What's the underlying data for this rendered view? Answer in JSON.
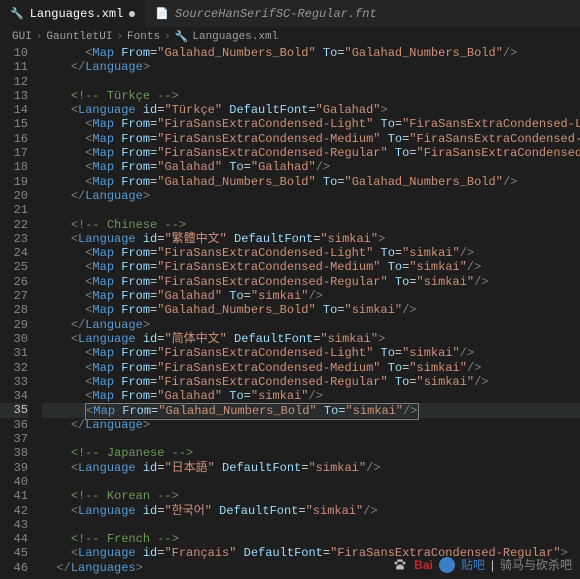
{
  "tabs": [
    {
      "icon": "🔧",
      "label": "Languages.xml",
      "active": true,
      "modified": true
    },
    {
      "icon": "📄",
      "label": "SourceHanSerifSC-Regular.fnt",
      "active": false,
      "modified": false
    }
  ],
  "breadcrumb": {
    "parts": [
      "GUI",
      "GauntletUI",
      "Fonts"
    ],
    "file_icon": "🔧",
    "file": "Languages.xml"
  },
  "code_lines": [
    {
      "n": 10,
      "ind": 3,
      "type": "map_self",
      "from": "Galahad_Numbers_Bold",
      "to": "Galahad_Numbers_Bold"
    },
    {
      "n": 11,
      "ind": 2,
      "type": "close",
      "tag": "Language"
    },
    {
      "n": 12,
      "ind": 0,
      "type": "blank"
    },
    {
      "n": 13,
      "ind": 2,
      "type": "comment",
      "text": " Türkçe "
    },
    {
      "n": 14,
      "ind": 2,
      "type": "lang",
      "id": "Türkçe",
      "font": "Galahad"
    },
    {
      "n": 15,
      "ind": 3,
      "type": "map_self",
      "from": "FiraSansExtraCondensed-Light",
      "to": "FiraSansExtraCondensed-Light"
    },
    {
      "n": 16,
      "ind": 3,
      "type": "map_self",
      "from": "FiraSansExtraCondensed-Medium",
      "to": "FiraSansExtraCondensed-Medium"
    },
    {
      "n": 17,
      "ind": 3,
      "type": "map_self",
      "from": "FiraSansExtraCondensed-Regular",
      "to": "FiraSansExtraCondensed-Regular"
    },
    {
      "n": 18,
      "ind": 3,
      "type": "map_self",
      "from": "Galahad",
      "to": "Galahad"
    },
    {
      "n": 19,
      "ind": 3,
      "type": "map_self",
      "from": "Galahad_Numbers_Bold",
      "to": "Galahad_Numbers_Bold"
    },
    {
      "n": 20,
      "ind": 2,
      "type": "close",
      "tag": "Language"
    },
    {
      "n": 21,
      "ind": 0,
      "type": "blank"
    },
    {
      "n": 22,
      "ind": 2,
      "type": "comment",
      "text": " Chinese "
    },
    {
      "n": 23,
      "ind": 2,
      "type": "lang",
      "id": "繁體中文",
      "font": "simkai"
    },
    {
      "n": 24,
      "ind": 3,
      "type": "map_self",
      "from": "FiraSansExtraCondensed-Light",
      "to": "simkai"
    },
    {
      "n": 25,
      "ind": 3,
      "type": "map_self",
      "from": "FiraSansExtraCondensed-Medium",
      "to": "simkai"
    },
    {
      "n": 26,
      "ind": 3,
      "type": "map_self",
      "from": "FiraSansExtraCondensed-Regular",
      "to": "simkai"
    },
    {
      "n": 27,
      "ind": 3,
      "type": "map_self",
      "from": "Galahad",
      "to": "simkai"
    },
    {
      "n": 28,
      "ind": 3,
      "type": "map_self",
      "from": "Galahad_Numbers_Bold",
      "to": "simkai"
    },
    {
      "n": 29,
      "ind": 2,
      "type": "close",
      "tag": "Language"
    },
    {
      "n": 30,
      "ind": 2,
      "type": "lang",
      "id": "简体中文",
      "font": "simkai"
    },
    {
      "n": 31,
      "ind": 3,
      "type": "map_self",
      "from": "FiraSansExtraCondensed-Light",
      "to": "simkai"
    },
    {
      "n": 32,
      "ind": 3,
      "type": "map_self",
      "from": "FiraSansExtraCondensed-Medium",
      "to": "simkai"
    },
    {
      "n": 33,
      "ind": 3,
      "type": "map_self",
      "from": "FiraSansExtraCondensed-Regular",
      "to": "simkai"
    },
    {
      "n": 34,
      "ind": 3,
      "type": "map_self",
      "from": "Galahad",
      "to": "simkai"
    },
    {
      "n": 35,
      "ind": 3,
      "type": "map_self_cursor",
      "from": "Galahad_Numbers_Bold",
      "to": "simkai"
    },
    {
      "n": 36,
      "ind": 2,
      "type": "close",
      "tag": "Language"
    },
    {
      "n": 37,
      "ind": 0,
      "type": "blank"
    },
    {
      "n": 38,
      "ind": 2,
      "type": "comment",
      "text": " Japanese "
    },
    {
      "n": 39,
      "ind": 2,
      "type": "lang_self",
      "id": "日本語",
      "font": "simkai"
    },
    {
      "n": 40,
      "ind": 0,
      "type": "blank"
    },
    {
      "n": 41,
      "ind": 2,
      "type": "comment",
      "text": " Korean "
    },
    {
      "n": 42,
      "ind": 2,
      "type": "lang_self",
      "id": "한국어",
      "font": "simkai"
    },
    {
      "n": 43,
      "ind": 0,
      "type": "blank"
    },
    {
      "n": 44,
      "ind": 2,
      "type": "comment",
      "text": " French "
    },
    {
      "n": 45,
      "ind": 2,
      "type": "lang",
      "id": "Français",
      "font": "FiraSansExtraCondensed-Regular"
    },
    {
      "n": 46,
      "ind": 1,
      "type": "close",
      "tag": "Languages"
    }
  ],
  "current_line": 35,
  "watermark": {
    "brand": "Bai",
    "brand2": "贴吧",
    "text": "骑马与砍杀吧"
  }
}
